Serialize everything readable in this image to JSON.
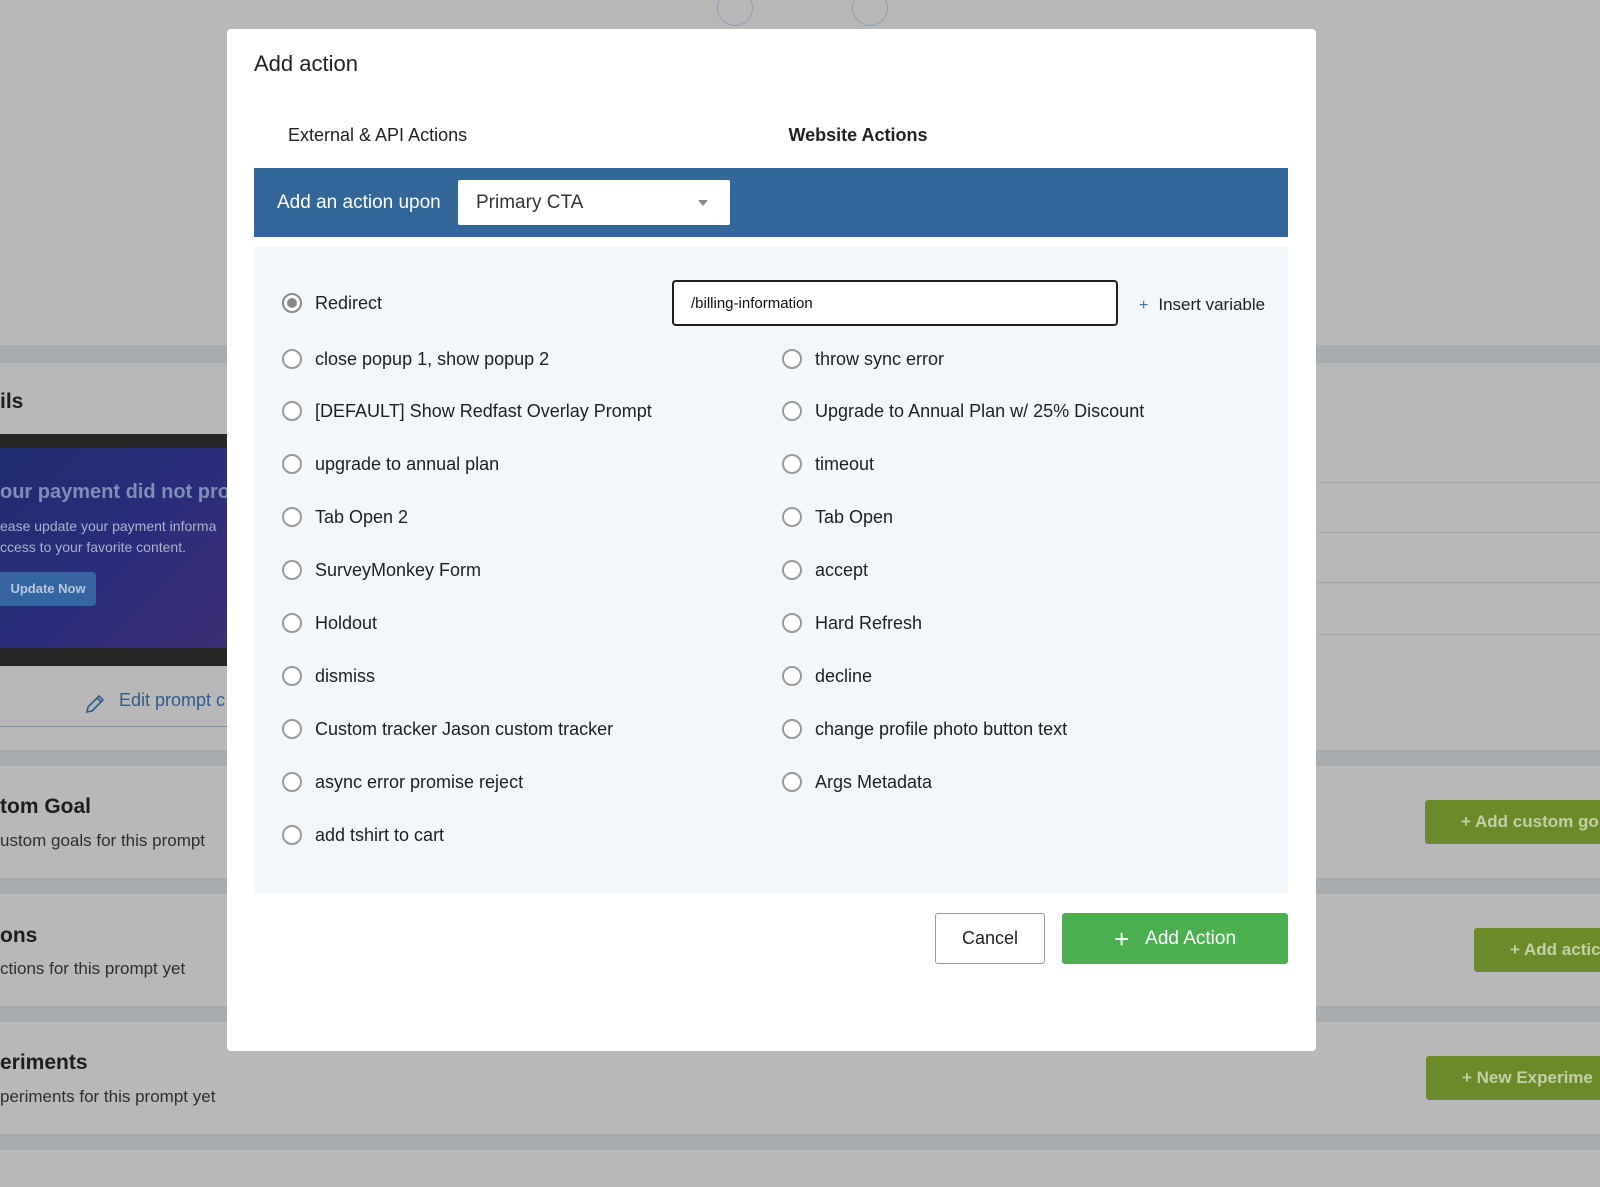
{
  "background": {
    "prompt_details_title": "ils",
    "preview": {
      "heading": "our payment did not proce",
      "line1": "ease update your payment informa",
      "line2": "ccess to your favorite content.",
      "button": "Update Now"
    },
    "edit_prompt": "Edit prompt c",
    "custom_goal": {
      "title": "tom Goal",
      "subtitle": "ustom goals for this prompt",
      "button": "+ Add custom go"
    },
    "actions": {
      "title": "ons",
      "subtitle": "ctions for this prompt yet",
      "button": "+ Add actic"
    },
    "experiments": {
      "title": "eriments",
      "subtitle": "periments for this prompt yet",
      "button": "+ New Experime"
    }
  },
  "modal": {
    "title": "Add action",
    "tabs": [
      {
        "label": "External & API Actions",
        "active": false
      },
      {
        "label": "Website Actions",
        "active": true
      }
    ],
    "trigger": {
      "label": "Add an action upon",
      "selected": "Primary CTA"
    },
    "redirect": {
      "label": "Redirect",
      "value": "/billing-information",
      "checked": true
    },
    "insert_variable": "Insert variable",
    "options_left": [
      "close popup 1, show popup 2",
      "[DEFAULT] Show Redfast Overlay Prompt",
      "upgrade to annual plan",
      "Tab Open 2",
      "SurveyMonkey Form",
      "Holdout",
      "dismiss",
      "Custom tracker Jason custom tracker",
      "async error promise reject",
      "add tshirt to cart"
    ],
    "options_right": [
      "throw sync error",
      "Upgrade to Annual Plan w/ 25% Discount",
      "timeout",
      "Tab Open",
      "accept",
      "Hard Refresh",
      "decline",
      "change profile photo button text",
      "Args Metadata"
    ],
    "cancel_label": "Cancel",
    "add_label": "Add Action"
  },
  "colors": {
    "bar": "#336699",
    "add_button": "#4caf50",
    "tab_underline": "#3a77b3"
  }
}
